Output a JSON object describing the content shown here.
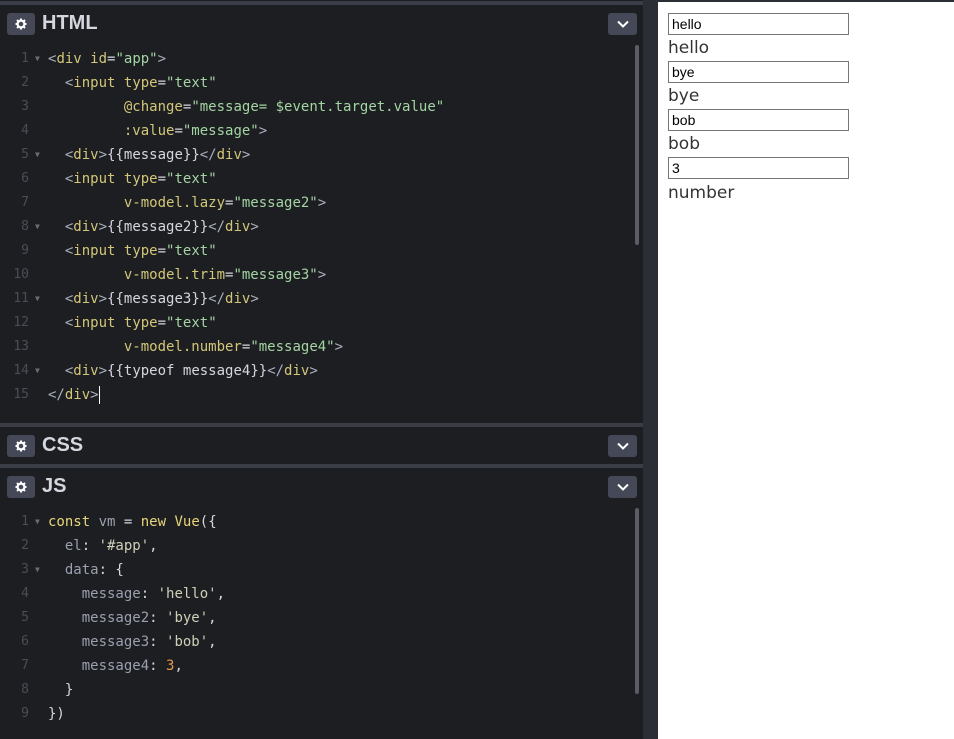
{
  "panels": {
    "html": {
      "title": "HTML"
    },
    "css": {
      "title": "CSS"
    },
    "js": {
      "title": "JS"
    }
  },
  "html_code": [
    {
      "n": "1",
      "fold": true,
      "tokens": [
        [
          "tag",
          "<"
        ],
        [
          "tagname",
          "div"
        ],
        [
          "punc",
          " "
        ],
        [
          "attr",
          "id"
        ],
        [
          "punc",
          "="
        ],
        [
          "str",
          "\"app\""
        ],
        [
          "tag",
          ">"
        ]
      ]
    },
    {
      "n": "2",
      "fold": false,
      "tokens": [
        [
          "punc",
          "  "
        ],
        [
          "tag",
          "<"
        ],
        [
          "tagname",
          "input"
        ],
        [
          "punc",
          " "
        ],
        [
          "attr",
          "type"
        ],
        [
          "punc",
          "="
        ],
        [
          "str",
          "\"text\""
        ]
      ]
    },
    {
      "n": "3",
      "fold": false,
      "tokens": [
        [
          "punc",
          "         "
        ],
        [
          "attr",
          "@change"
        ],
        [
          "punc",
          "="
        ],
        [
          "str",
          "\"message= $event.target.value\""
        ]
      ]
    },
    {
      "n": "4",
      "fold": false,
      "tokens": [
        [
          "punc",
          "         "
        ],
        [
          "attr",
          ":value"
        ],
        [
          "punc",
          "="
        ],
        [
          "str",
          "\"message\""
        ],
        [
          "tag",
          ">"
        ]
      ]
    },
    {
      "n": "5",
      "fold": true,
      "tokens": [
        [
          "punc",
          "  "
        ],
        [
          "tag",
          "<"
        ],
        [
          "tagname",
          "div"
        ],
        [
          "tag",
          ">"
        ],
        [
          "punc",
          "{{message}}"
        ],
        [
          "tag",
          "</"
        ],
        [
          "tagname",
          "div"
        ],
        [
          "tag",
          ">"
        ]
      ]
    },
    {
      "n": "6",
      "fold": false,
      "tokens": [
        [
          "punc",
          "  "
        ],
        [
          "tag",
          "<"
        ],
        [
          "tagname",
          "input"
        ],
        [
          "punc",
          " "
        ],
        [
          "attr",
          "type"
        ],
        [
          "punc",
          "="
        ],
        [
          "str",
          "\"text\""
        ]
      ]
    },
    {
      "n": "7",
      "fold": false,
      "tokens": [
        [
          "punc",
          "         "
        ],
        [
          "attr",
          "v-model.lazy"
        ],
        [
          "punc",
          "="
        ],
        [
          "str",
          "\"message2\""
        ],
        [
          "tag",
          ">"
        ]
      ]
    },
    {
      "n": "8",
      "fold": true,
      "tokens": [
        [
          "punc",
          "  "
        ],
        [
          "tag",
          "<"
        ],
        [
          "tagname",
          "div"
        ],
        [
          "tag",
          ">"
        ],
        [
          "punc",
          "{{message2}}"
        ],
        [
          "tag",
          "</"
        ],
        [
          "tagname",
          "div"
        ],
        [
          "tag",
          ">"
        ]
      ]
    },
    {
      "n": "9",
      "fold": false,
      "tokens": [
        [
          "punc",
          "  "
        ],
        [
          "tag",
          "<"
        ],
        [
          "tagname",
          "input"
        ],
        [
          "punc",
          " "
        ],
        [
          "attr",
          "type"
        ],
        [
          "punc",
          "="
        ],
        [
          "str",
          "\"text\""
        ]
      ]
    },
    {
      "n": "10",
      "fold": false,
      "tokens": [
        [
          "punc",
          "         "
        ],
        [
          "attr",
          "v-model.trim"
        ],
        [
          "punc",
          "="
        ],
        [
          "str",
          "\"message3\""
        ],
        [
          "tag",
          ">"
        ]
      ]
    },
    {
      "n": "11",
      "fold": true,
      "tokens": [
        [
          "punc",
          "  "
        ],
        [
          "tag",
          "<"
        ],
        [
          "tagname",
          "div"
        ],
        [
          "tag",
          ">"
        ],
        [
          "punc",
          "{{message3}}"
        ],
        [
          "tag",
          "</"
        ],
        [
          "tagname",
          "div"
        ],
        [
          "tag",
          ">"
        ]
      ]
    },
    {
      "n": "12",
      "fold": false,
      "tokens": [
        [
          "punc",
          "  "
        ],
        [
          "tag",
          "<"
        ],
        [
          "tagname",
          "input"
        ],
        [
          "punc",
          " "
        ],
        [
          "attr",
          "type"
        ],
        [
          "punc",
          "="
        ],
        [
          "str",
          "\"text\""
        ]
      ]
    },
    {
      "n": "13",
      "fold": false,
      "tokens": [
        [
          "punc",
          "         "
        ],
        [
          "attr",
          "v-model.number"
        ],
        [
          "punc",
          "="
        ],
        [
          "str",
          "\"message4\""
        ],
        [
          "tag",
          ">"
        ]
      ]
    },
    {
      "n": "14",
      "fold": true,
      "tokens": [
        [
          "punc",
          "  "
        ],
        [
          "tag",
          "<"
        ],
        [
          "tagname",
          "div"
        ],
        [
          "tag",
          ">"
        ],
        [
          "punc",
          "{{typeof message4}}"
        ],
        [
          "tag",
          "</"
        ],
        [
          "tagname",
          "div"
        ],
        [
          "tag",
          ">"
        ]
      ]
    },
    {
      "n": "15",
      "fold": false,
      "cursor": true,
      "tokens": [
        [
          "tag",
          "</"
        ],
        [
          "tagname",
          "div"
        ],
        [
          "tag",
          ">"
        ]
      ]
    }
  ],
  "js_code": [
    {
      "n": "1",
      "fold": true,
      "tokens": [
        [
          "kw",
          "const"
        ],
        [
          "punc",
          " "
        ],
        [
          "var",
          "vm"
        ],
        [
          "punc",
          " = "
        ],
        [
          "kw",
          "new"
        ],
        [
          "punc",
          " "
        ],
        [
          "kw",
          "Vue"
        ],
        [
          "punc",
          "({"
        ]
      ]
    },
    {
      "n": "2",
      "fold": false,
      "tokens": [
        [
          "punc",
          "  "
        ],
        [
          "prop",
          "el"
        ],
        [
          "punc",
          ": "
        ],
        [
          "str2",
          "'#app'"
        ],
        [
          "punc",
          ","
        ]
      ]
    },
    {
      "n": "3",
      "fold": true,
      "tokens": [
        [
          "punc",
          "  "
        ],
        [
          "prop",
          "data"
        ],
        [
          "punc",
          ": {"
        ]
      ]
    },
    {
      "n": "4",
      "fold": false,
      "tokens": [
        [
          "punc",
          "    "
        ],
        [
          "prop",
          "message"
        ],
        [
          "punc",
          ": "
        ],
        [
          "str2",
          "'hello'"
        ],
        [
          "punc",
          ","
        ]
      ]
    },
    {
      "n": "5",
      "fold": false,
      "tokens": [
        [
          "punc",
          "    "
        ],
        [
          "prop",
          "message2"
        ],
        [
          "punc",
          ": "
        ],
        [
          "str2",
          "'bye'"
        ],
        [
          "punc",
          ","
        ]
      ]
    },
    {
      "n": "6",
      "fold": false,
      "tokens": [
        [
          "punc",
          "    "
        ],
        [
          "prop",
          "message3"
        ],
        [
          "punc",
          ": "
        ],
        [
          "str2",
          "'bob'"
        ],
        [
          "punc",
          ","
        ]
      ]
    },
    {
      "n": "7",
      "fold": false,
      "tokens": [
        [
          "punc",
          "    "
        ],
        [
          "prop",
          "message4"
        ],
        [
          "punc",
          ": "
        ],
        [
          "num",
          "3"
        ],
        [
          "punc",
          ","
        ]
      ]
    },
    {
      "n": "8",
      "fold": false,
      "tokens": [
        [
          "punc",
          "  }"
        ]
      ]
    },
    {
      "n": "9",
      "fold": false,
      "tokens": [
        [
          "punc",
          "})"
        ]
      ]
    }
  ],
  "result": {
    "input1": "hello",
    "text1": "hello",
    "input2": "bye",
    "text2": "bye",
    "input3": "bob",
    "text3": "bob",
    "input4": "3",
    "text4": "number"
  },
  "icons": {
    "panel_settings": "gear-icon",
    "panel_collapse": "chevron-down-icon"
  }
}
